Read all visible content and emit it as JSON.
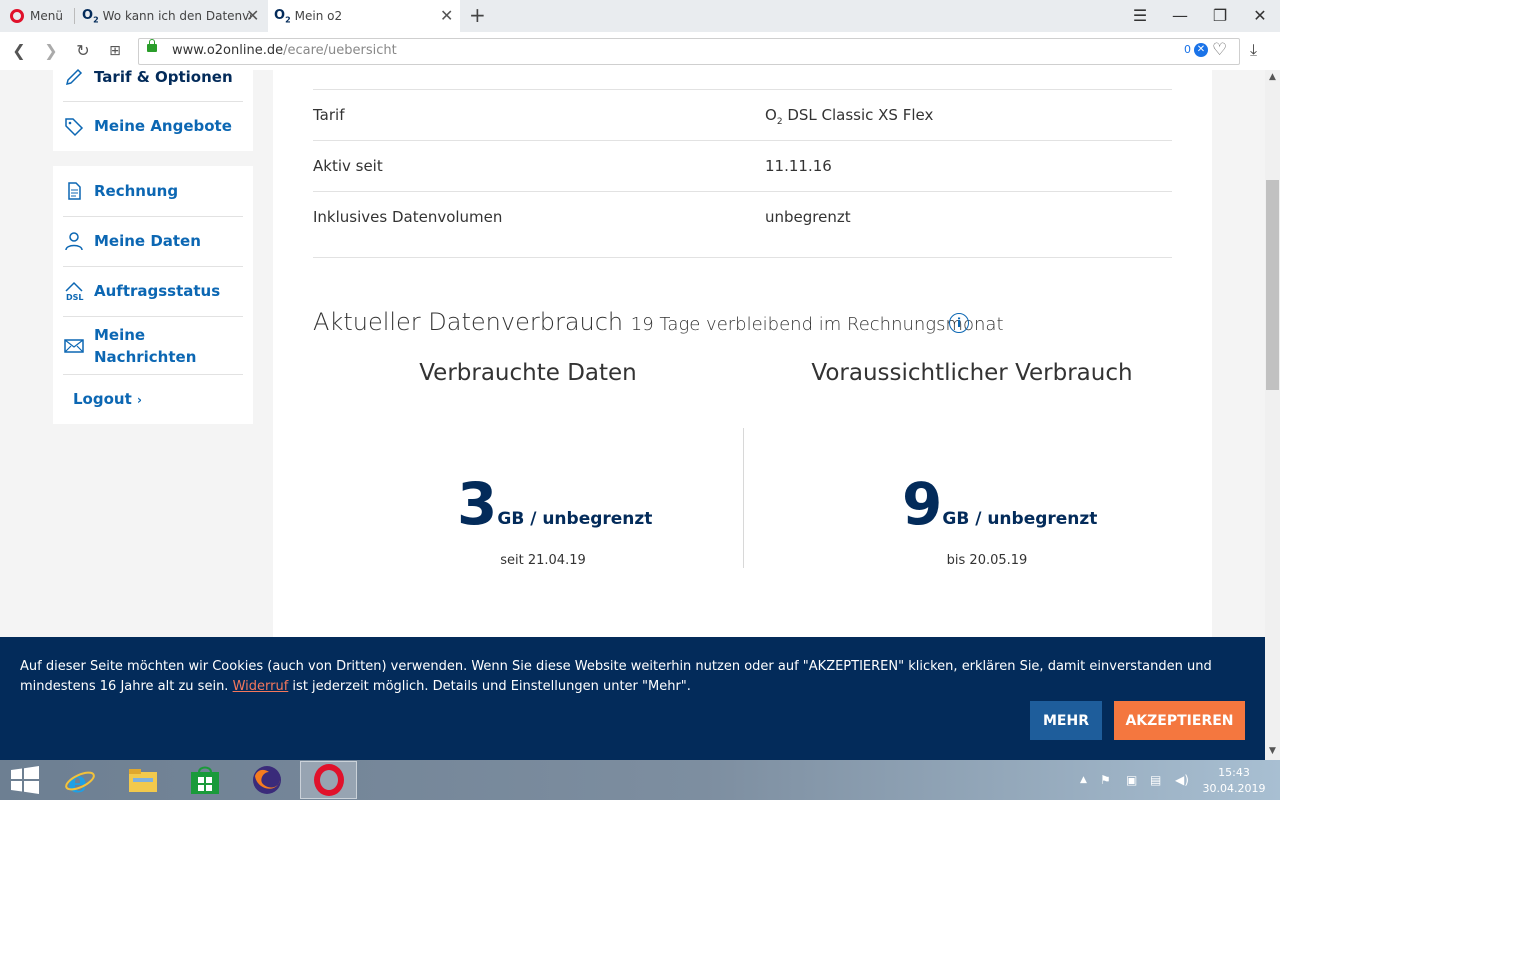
{
  "browser": {
    "menu_label": "Menü",
    "tabs": [
      {
        "title": "Wo kann ich den Datenver"
      },
      {
        "title": "Mein o2"
      }
    ],
    "url_host": "www.o2online.de",
    "url_path": "/ecare/uebersicht",
    "adblock_count": "0"
  },
  "sidebar": {
    "group1": [
      {
        "label": "Tarif & Optionen",
        "icon": "pencil-icon"
      },
      {
        "label": "Meine Angebote",
        "icon": "tag-icon"
      }
    ],
    "group2": [
      {
        "label": "Rechnung",
        "icon": "document-icon"
      },
      {
        "label": "Meine Daten",
        "icon": "user-icon"
      },
      {
        "label": "Auftragsstatus",
        "icon": "dsl-house-icon"
      },
      {
        "label": "Meine\nNachrichten",
        "icon": "envelope-icon"
      }
    ],
    "logout_label": "Logout"
  },
  "details": [
    {
      "label": "Tarif",
      "value_prefix": "O",
      "value_sub": "2",
      "value": " DSL Classic XS Flex"
    },
    {
      "label": "Aktiv seit",
      "value": "11.11.16"
    },
    {
      "label": "Inklusives Datenvolumen",
      "value": "unbegrenzt"
    }
  ],
  "usage": {
    "title": "Aktueller Datenverbrauch",
    "subtitle": "19 Tage verbleibend im Rechnungsmonat",
    "used": {
      "heading": "Verbrauchte Daten",
      "amount": "3",
      "unit": "GB / unbegrenzt",
      "date_text": "seit 21.04.19"
    },
    "forecast": {
      "heading": "Voraussichtlicher Verbrauch",
      "amount": "9",
      "unit": "GB / unbegrenzt",
      "date_text": "bis 20.05.19"
    }
  },
  "cookie": {
    "text_before": "Auf dieser Seite möchten wir Cookies (auch von Dritten) verwenden. Wenn Sie diese Website weiterhin nutzen oder auf \"AKZEPTIEREN\" klicken, erklären Sie, damit einverstanden und mindestens 16 Jahre alt zu sein. ",
    "link": "Widerruf",
    "text_after": " ist jederzeit möglich. Details und Einstellungen unter \"Mehr\".",
    "more_label": "MEHR",
    "accept_label": "AKZEPTIEREN",
    "colors": {
      "banner": "#032b5a",
      "accept": "#f4773f",
      "more": "#1e5d9b",
      "link": "#f4775c"
    }
  },
  "taskbar": {
    "time": "15:43",
    "date": "30.04.2019"
  },
  "colors": {
    "brand_blue": "#0c67b3",
    "brand_dark": "#032b5a"
  }
}
